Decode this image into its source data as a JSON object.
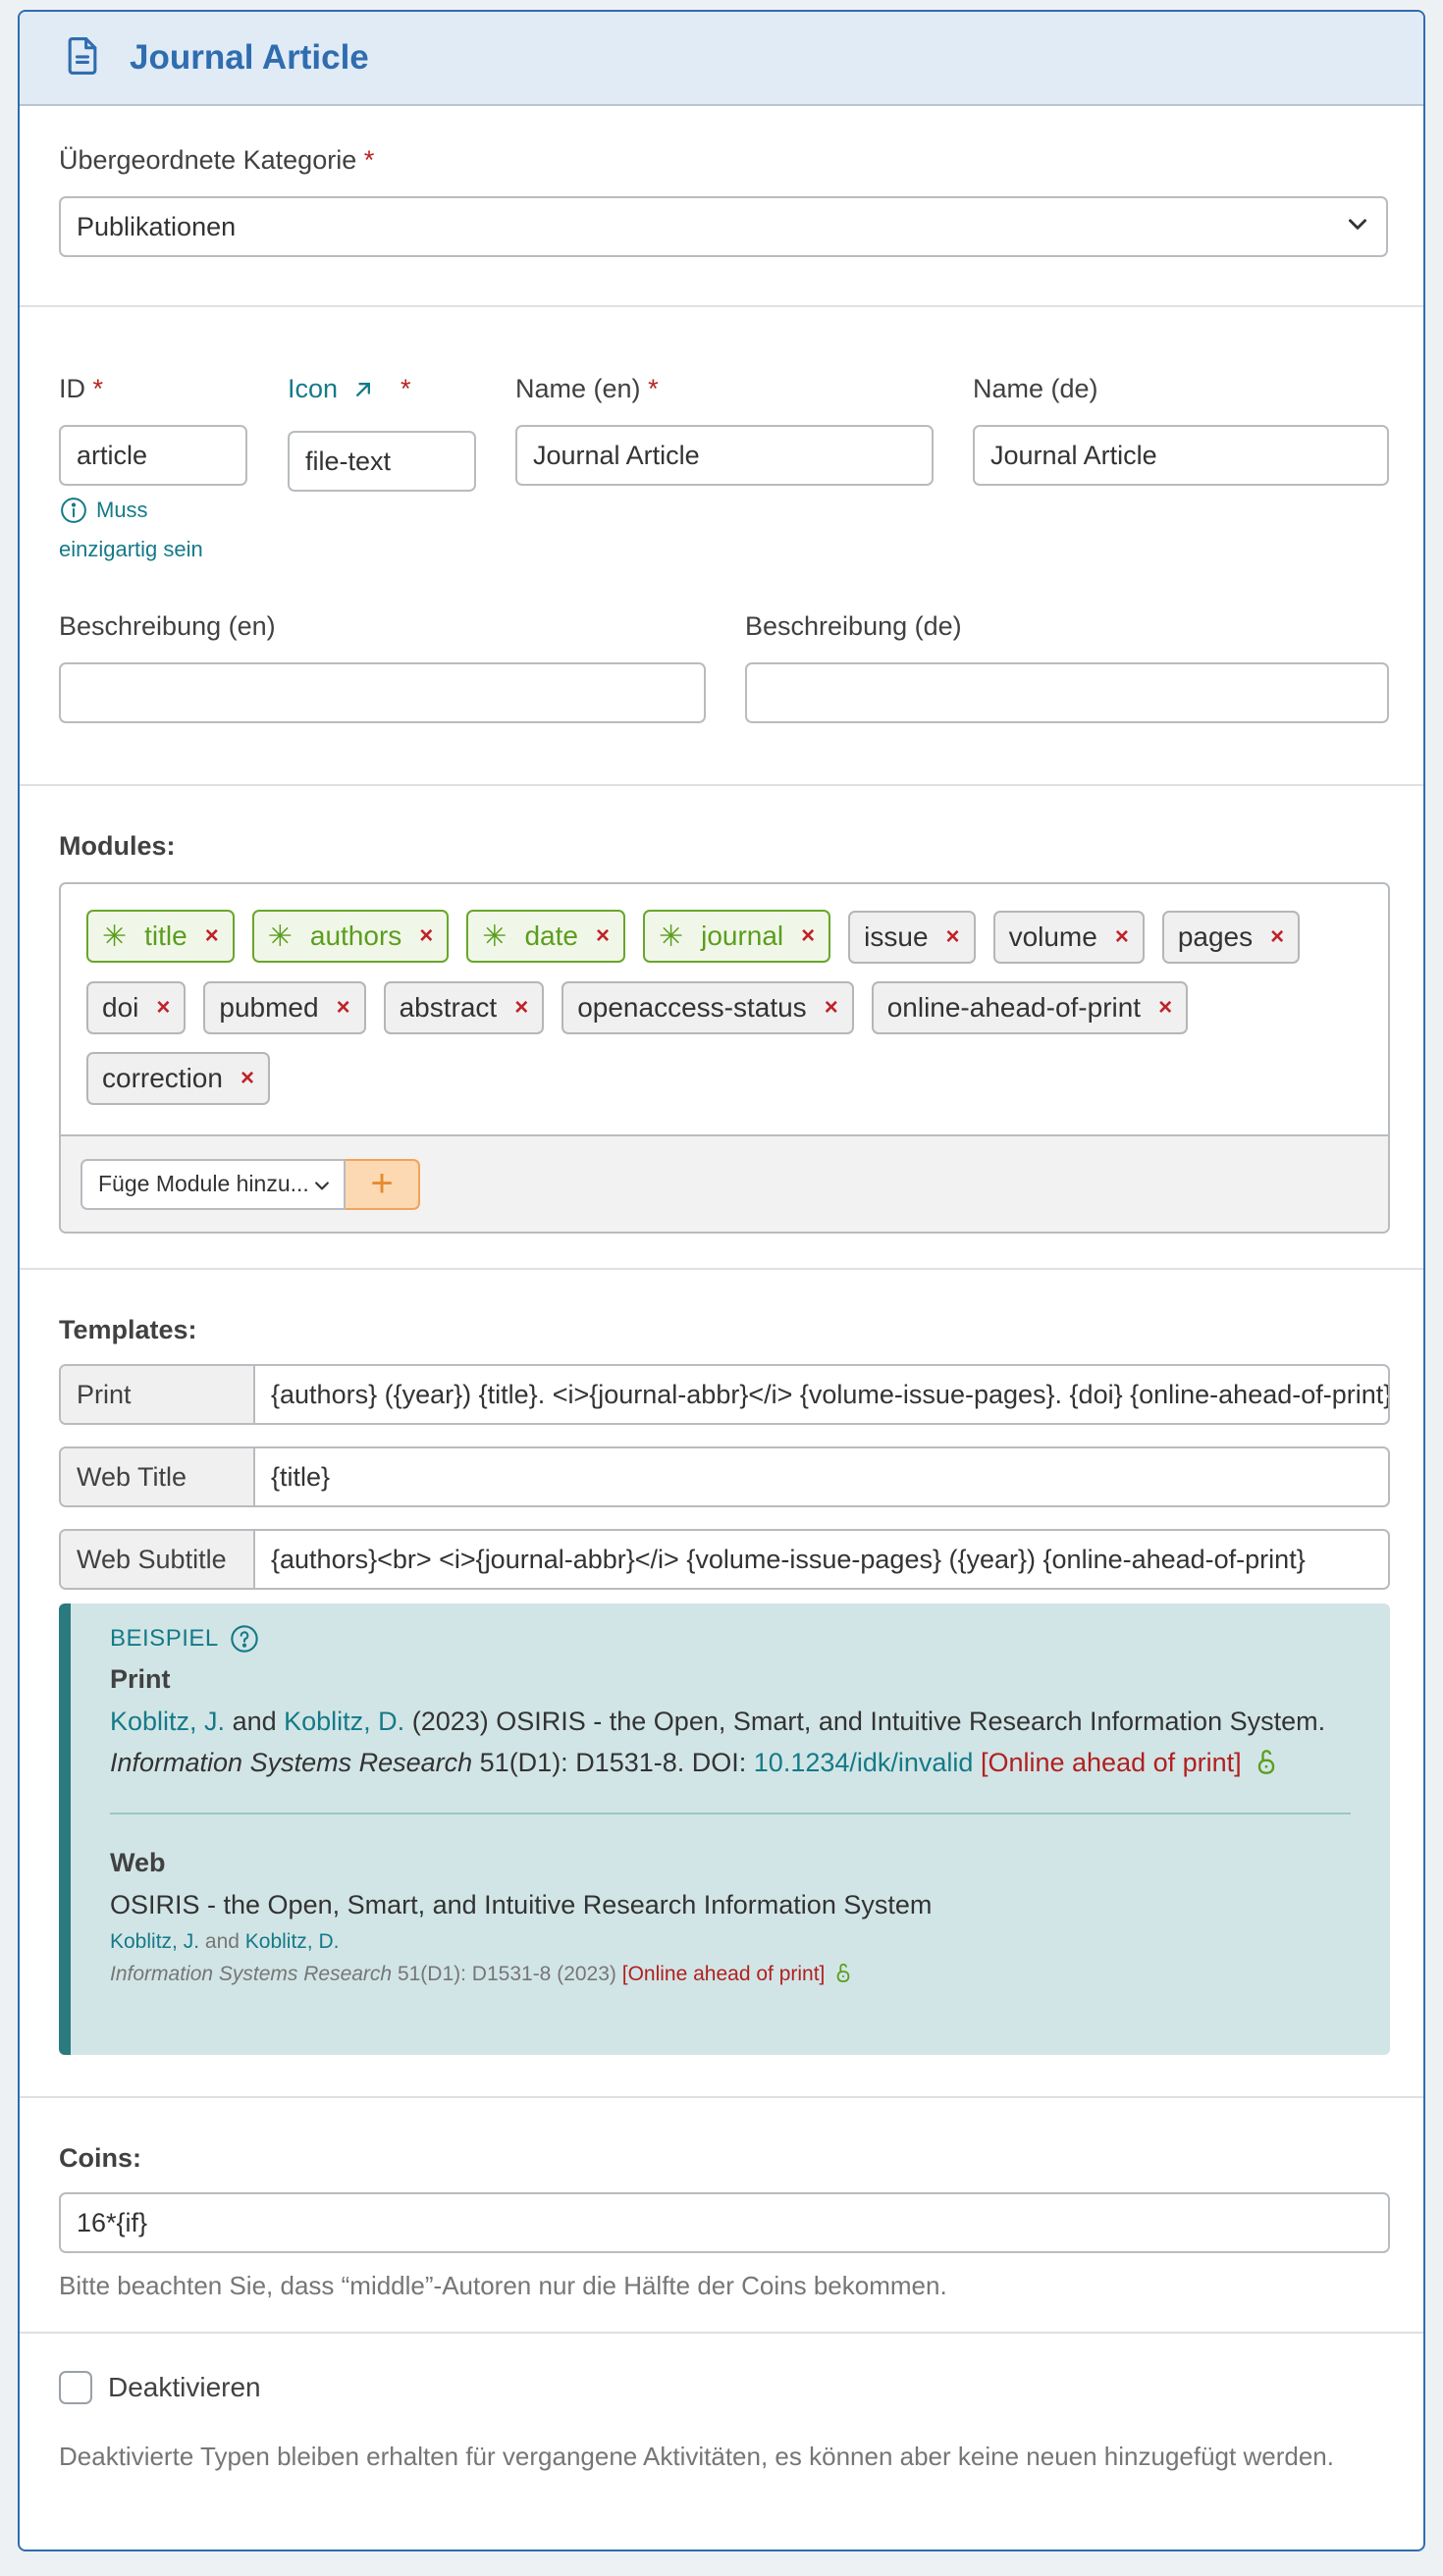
{
  "header": {
    "title": "Journal Article",
    "icon": "file-text-icon"
  },
  "parent_category": {
    "label": "Übergeordnete Kategorie",
    "required": "*",
    "value": "Publikationen"
  },
  "fields": {
    "id": {
      "label": "ID",
      "required": "*",
      "value": "article",
      "hint_line1": "Muss",
      "hint_line2": "einzigartig sein"
    },
    "icon": {
      "label": "Icon",
      "required": "*",
      "value": "file-text"
    },
    "name_en": {
      "label": "Name (en)",
      "required": "*",
      "value": "Journal Article"
    },
    "name_de": {
      "label": "Name (de)",
      "value": "Journal Article"
    },
    "desc_en": {
      "label": "Beschreibung (en)",
      "value": ""
    },
    "desc_de": {
      "label": "Beschreibung (de)",
      "value": ""
    }
  },
  "modules": {
    "label": "Modules:",
    "items": [
      {
        "name": "title",
        "required": true
      },
      {
        "name": "authors",
        "required": true
      },
      {
        "name": "date",
        "required": true
      },
      {
        "name": "journal",
        "required": true
      },
      {
        "name": "issue",
        "required": false
      },
      {
        "name": "volume",
        "required": false
      },
      {
        "name": "pages",
        "required": false
      },
      {
        "name": "doi",
        "required": false
      },
      {
        "name": "pubmed",
        "required": false
      },
      {
        "name": "abstract",
        "required": false
      },
      {
        "name": "openaccess-status",
        "required": false
      },
      {
        "name": "online-ahead-of-print",
        "required": false
      },
      {
        "name": "correction",
        "required": false
      }
    ],
    "add_select": "Füge Module hinzu...",
    "remove_glyph": "×",
    "required_glyph": "✳",
    "add_glyph": "+"
  },
  "templates": {
    "label": "Templates:",
    "rows": [
      {
        "key": "Print",
        "value": "{authors} ({year}) {title}. <i>{journal-abbr}</i> {volume-issue-pages}. {doi} {online-ahead-of-print}"
      },
      {
        "key": "Web Title",
        "value": "{title}"
      },
      {
        "key": "Web Subtitle",
        "value": "{authors}<br> <i>{journal-abbr}</i> {volume-issue-pages} ({year}) {online-ahead-of-print}"
      }
    ]
  },
  "example": {
    "title": "BEISPIEL",
    "print_heading": "Print",
    "author1": "Koblitz, J.",
    "and": "and",
    "author2": "Koblitz, D.",
    "print_text1": "(2023) OSIRIS - the Open, Smart, and Intuitive Research Information System.",
    "journal": "Information Systems Research",
    "print_text2": "51(D1): D1531-8. DOI:",
    "doi": "10.1234/idk/invalid",
    "ahead": "[Online ahead of print]",
    "web_heading": "Web",
    "web_title": "OSIRIS - the Open, Smart, and Intuitive Research Information System",
    "web_meta": "51(D1): D1531-8 (2023)"
  },
  "coins": {
    "label": "Coins:",
    "value": "16*{if}",
    "hint": "Bitte beachten Sie, dass “middle”-Autoren nur die Hälfte der Coins bekommen."
  },
  "deactivate": {
    "label": "Deaktivieren",
    "hint": "Deaktivierte Typen bleiben erhalten für vergangene Aktivitäten, es können aber keine neuen hinzugefügt werden."
  },
  "colors": {
    "accent": "#2f6db0",
    "teal": "#157a88",
    "required_border": "#69a62a",
    "remove": "#c0222a",
    "add_button": "#f2a35a"
  }
}
